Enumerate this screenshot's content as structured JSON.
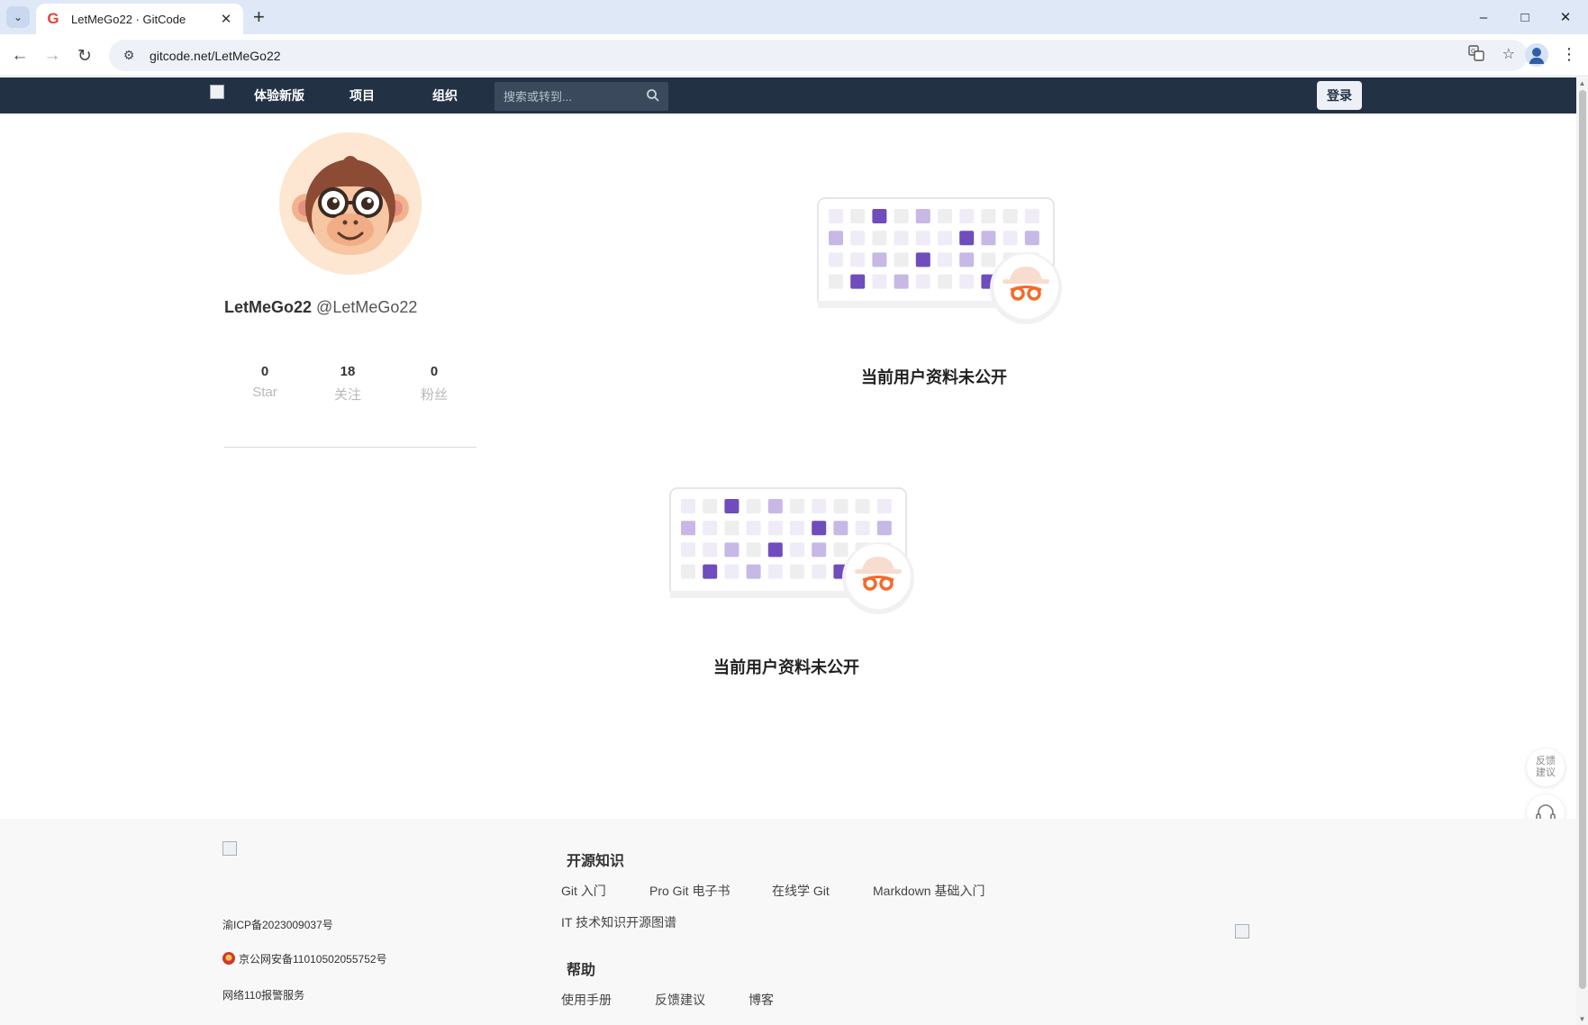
{
  "browser": {
    "tab_title": "LetMeGo22 · GitCode",
    "tab_favicon": "G",
    "url": "gitcode.net/LetMeGo22"
  },
  "nav": {
    "items": [
      "体验新版",
      "项目",
      "组织"
    ],
    "search_placeholder": "搜索或转到...",
    "login_label": "登录"
  },
  "profile": {
    "display_name": "LetMeGo22",
    "handle": "@LetMeGo22",
    "stats": [
      {
        "value": "0",
        "label": "Star"
      },
      {
        "value": "18",
        "label": "关注"
      },
      {
        "value": "0",
        "label": "粉丝"
      }
    ]
  },
  "private_blocks": [
    {
      "message": "当前用户资料未公开"
    },
    {
      "message": "当前用户资料未公开"
    }
  ],
  "heatmap_pattern": [
    [
      0,
      1,
      3,
      1,
      2,
      1,
      0,
      1,
      1,
      0
    ],
    [
      2,
      0,
      1,
      0,
      0,
      0,
      3,
      2,
      0,
      2
    ],
    [
      0,
      0,
      2,
      1,
      3,
      0,
      2,
      1,
      1,
      0
    ],
    [
      1,
      3,
      0,
      2,
      0,
      1,
      0,
      3,
      1,
      0
    ]
  ],
  "colors": {
    "nav_bg": "#223244",
    "accent": "#6f4dbd",
    "cell_light": "#efecf8",
    "cell_gray": "#eeeeee",
    "cell_mid": "#c8b8e6",
    "badge_glasses": "#f26b2d"
  },
  "side_float": {
    "feedback_label": "反馈建议"
  },
  "footer": {
    "icp": "渝ICP备2023009037号",
    "police": "京公网安备11010502055752号",
    "net110": "网络110报警服务",
    "sections": [
      {
        "title": "开源知识",
        "links": [
          "Git 入门",
          "Pro Git 电子书",
          "在线学 Git",
          "Markdown 基础入门",
          "IT 技术知识开源图谱"
        ]
      },
      {
        "title": "帮助",
        "links": [
          "使用手册",
          "反馈建议",
          "博客"
        ]
      }
    ]
  }
}
